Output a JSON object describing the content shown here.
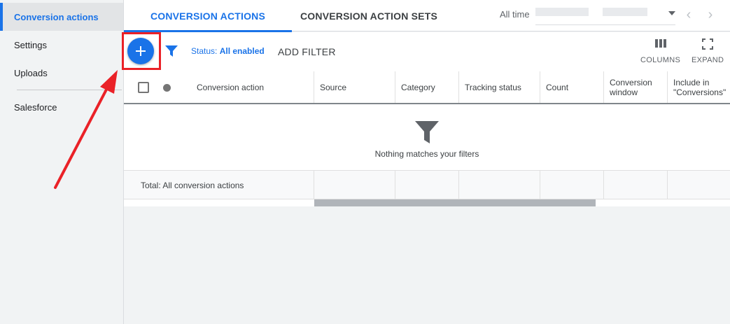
{
  "sidebar": {
    "items": [
      {
        "label": "Conversion actions",
        "active": true
      },
      {
        "label": "Settings",
        "active": false
      },
      {
        "label": "Uploads",
        "active": false
      },
      {
        "label": "Salesforce",
        "active": false
      }
    ]
  },
  "tabs": [
    {
      "label": "CONVERSION ACTIONS",
      "active": true
    },
    {
      "label": "CONVERSION ACTION SETS",
      "active": false
    }
  ],
  "date_range": {
    "label": "All time"
  },
  "toolbar": {
    "add_icon": "plus-icon",
    "filter_icon": "funnel-icon",
    "status_prefix": "Status:",
    "status_value": "All enabled",
    "add_filter_label": "ADD FILTER",
    "columns_label": "COLUMNS",
    "expand_label": "EXPAND"
  },
  "table": {
    "columns": [
      "Conversion action",
      "Source",
      "Category",
      "Tracking status",
      "Count",
      "Conversion window",
      "Include in \"Conversions\""
    ],
    "empty_message": "Nothing matches your filters",
    "total_label": "Total: All conversion actions"
  },
  "colors": {
    "accent": "#1a73e8",
    "annotation": "#ea2127"
  }
}
